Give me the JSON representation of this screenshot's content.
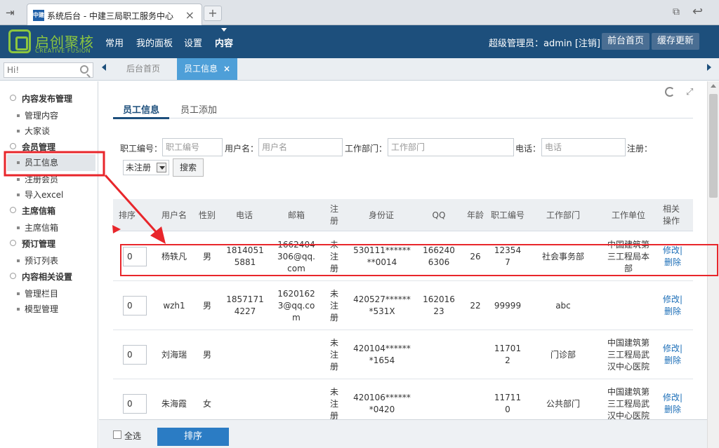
{
  "browser": {
    "tab_title": "系统后台 - 中建三局职工服务中心",
    "favicon_text": "中建"
  },
  "header": {
    "logo_text": "启创聚核",
    "logo_sub": "CREATIVE FUSION",
    "nav": [
      "常用",
      "我的面板",
      "设置",
      "内容"
    ],
    "admin_info": "超级管理员：admin [注销]",
    "btn_home": "前台首页",
    "btn_cache": "缓存更新"
  },
  "subbar": {
    "search_placeholder": "Hi!",
    "tab_home": "后台首页",
    "tab_current": "员工信息",
    "tab_close": "×"
  },
  "sidebar": {
    "groups": [
      {
        "label": "内容发布管理",
        "items": [
          "管理内容",
          "大家谈"
        ]
      },
      {
        "label": "会员管理",
        "items": [
          "员工信息",
          "注册会员",
          "导入excel"
        ]
      },
      {
        "label": "主席信箱",
        "items": [
          "主席信箱"
        ]
      },
      {
        "label": "预订管理",
        "items": [
          "预订列表"
        ]
      },
      {
        "label": "内容相关设置",
        "items": [
          "管理栏目",
          "模型管理"
        ]
      }
    ]
  },
  "content": {
    "tabs": [
      "员工信息",
      "员工添加"
    ],
    "filters": {
      "emp_no_label": "职工编号：",
      "emp_no_placeholder": "职工编号",
      "username_label": "用户名：",
      "username_placeholder": "用户名",
      "dept_label": "工作部门：",
      "dept_placeholder": "工作部门",
      "phone_label": "电话：",
      "phone_placeholder": "电话",
      "reg_label": "注册：",
      "reg_value": "未注册",
      "search_button": "搜索"
    },
    "table": {
      "headers": [
        "排序",
        "用户名",
        "性别",
        "电话",
        "邮箱",
        "注册",
        "身份证",
        "QQ",
        "年龄",
        "职工编号",
        "工作部门",
        "工作单位",
        "相关操作"
      ],
      "rows": [
        {
          "sort": "0",
          "username": "杨轶凡",
          "gender": "男",
          "phone": "18140515881",
          "email": "1662404306@qq.com",
          "reg": "未注册",
          "idcard": "530111********0014",
          "qq": "1662406306",
          "age": "26",
          "emp_no": "123547",
          "dept": "社会事务部",
          "unit": "中国建筑第三工程局本部",
          "edit": "修改|",
          "del": "删除"
        },
        {
          "sort": "0",
          "username": "wzh1",
          "gender": "男",
          "phone": "18571714227",
          "email": "16201623@qq.com",
          "reg": "未注册",
          "idcard": "420527*******531X",
          "qq": "16201623",
          "age": "22",
          "emp_no": "99999",
          "dept": "abc",
          "unit": "",
          "edit": "修改|",
          "del": "删除"
        },
        {
          "sort": "0",
          "username": "刘海瑞",
          "gender": "男",
          "phone": "",
          "email": "",
          "reg": "未注册",
          "idcard": "420104*******1654",
          "qq": "",
          "age": "",
          "emp_no": "117012",
          "dept": "门诊部",
          "unit": "中国建筑第三工程局武汉中心医院",
          "edit": "修改|",
          "del": "删除"
        },
        {
          "sort": "0",
          "username": "朱海霞",
          "gender": "女",
          "phone": "",
          "email": "",
          "reg": "未注册",
          "idcard": "420106*******0420",
          "qq": "",
          "age": "",
          "emp_no": "117110",
          "dept": "公共部门",
          "unit": "中国建筑第三工程局武汉中心医院",
          "edit": "修改|",
          "del": "删除"
        }
      ]
    }
  },
  "bottom": {
    "check_all": "全选",
    "sort_button": "排序"
  },
  "colors": {
    "header_bg": "#1d4f7c",
    "logo_green": "#8cc63f",
    "tab_active": "#4e9fd8",
    "annotation_red": "#e8262b",
    "link_blue": "#1d6fb8"
  }
}
